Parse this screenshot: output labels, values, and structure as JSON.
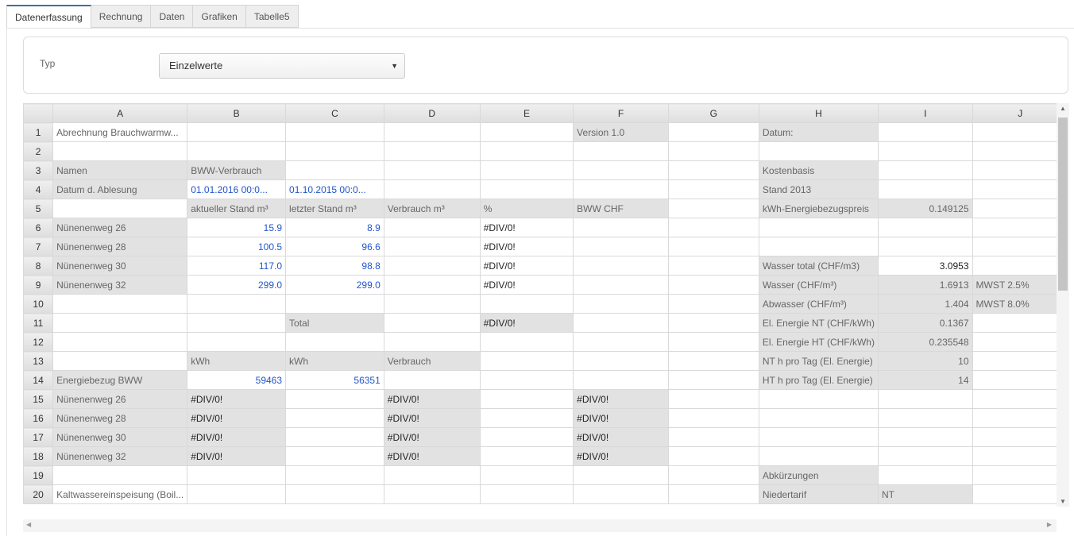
{
  "tabs": [
    "Datenerfassung",
    "Rechnung",
    "Daten",
    "Grafiken",
    "Tabelle5"
  ],
  "active_tab": 0,
  "form": {
    "typ_label": "Typ",
    "typ_value": "Einzelwerte"
  },
  "columns": [
    "A",
    "B",
    "C",
    "D",
    "E",
    "F",
    "G",
    "H",
    "I",
    "J"
  ],
  "rows": [
    [
      [
        "Abrechnung Brauchwarmw...",
        ""
      ],
      [
        "",
        ""
      ],
      [
        "",
        ""
      ],
      [
        "",
        ""
      ],
      [
        "",
        ""
      ],
      [
        "Version 1.0",
        "g"
      ],
      [
        "",
        ""
      ],
      [
        "Datum:",
        "g"
      ],
      [
        "",
        ""
      ],
      [
        "",
        ""
      ]
    ],
    [
      [
        "",
        ""
      ],
      [
        "",
        ""
      ],
      [
        "",
        ""
      ],
      [
        "",
        ""
      ],
      [
        "",
        ""
      ],
      [
        "",
        ""
      ],
      [
        "",
        ""
      ],
      [
        "",
        ""
      ],
      [
        "",
        ""
      ],
      [
        "",
        ""
      ]
    ],
    [
      [
        "Namen",
        "g"
      ],
      [
        "BWW-Verbrauch",
        "g"
      ],
      [
        "",
        ""
      ],
      [
        "",
        ""
      ],
      [
        "",
        ""
      ],
      [
        "",
        ""
      ],
      [
        "",
        ""
      ],
      [
        "Kostenbasis",
        "g"
      ],
      [
        "",
        ""
      ],
      [
        "",
        ""
      ]
    ],
    [
      [
        "Datum d. Ablesung",
        "g"
      ],
      [
        "01.01.2016 00:0...",
        "b"
      ],
      [
        "01.10.2015 00:0...",
        "b"
      ],
      [
        "",
        ""
      ],
      [
        "",
        ""
      ],
      [
        "",
        ""
      ],
      [
        "",
        ""
      ],
      [
        "Stand 2013",
        "g"
      ],
      [
        "",
        ""
      ],
      [
        "",
        ""
      ]
    ],
    [
      [
        "",
        ""
      ],
      [
        "aktueller Stand m³",
        "g"
      ],
      [
        "letzter Stand m³",
        "g"
      ],
      [
        "Verbrauch m³",
        "g"
      ],
      [
        "%",
        "g"
      ],
      [
        "BWW CHF",
        "g"
      ],
      [
        "",
        ""
      ],
      [
        "kWh-Energiebezugspreis",
        "g"
      ],
      [
        "0.149125",
        "gr"
      ],
      [
        "",
        ""
      ]
    ],
    [
      [
        "Nünenenweg 26",
        "g"
      ],
      [
        "15.9",
        "br"
      ],
      [
        "8.9",
        "br"
      ],
      [
        "",
        ""
      ],
      [
        "#DIV/0!",
        "k"
      ],
      [
        "",
        ""
      ],
      [
        "",
        ""
      ],
      [
        "",
        ""
      ],
      [
        "",
        ""
      ],
      [
        "",
        ""
      ]
    ],
    [
      [
        "Nünenenweg 28",
        "g"
      ],
      [
        "100.5",
        "br"
      ],
      [
        "96.6",
        "br"
      ],
      [
        "",
        ""
      ],
      [
        "#DIV/0!",
        "k"
      ],
      [
        "",
        ""
      ],
      [
        "",
        ""
      ],
      [
        "",
        ""
      ],
      [
        "",
        ""
      ],
      [
        "",
        ""
      ]
    ],
    [
      [
        "Nünenenweg 30",
        "g"
      ],
      [
        "117.0",
        "br"
      ],
      [
        "98.8",
        "br"
      ],
      [
        "",
        ""
      ],
      [
        "#DIV/0!",
        "k"
      ],
      [
        "",
        ""
      ],
      [
        "",
        ""
      ],
      [
        "Wasser total (CHF/m3)",
        "g"
      ],
      [
        "3.0953",
        "kr"
      ],
      [
        "",
        ""
      ]
    ],
    [
      [
        "Nünenenweg 32",
        "g"
      ],
      [
        "299.0",
        "br"
      ],
      [
        "299.0",
        "br"
      ],
      [
        "",
        ""
      ],
      [
        "#DIV/0!",
        "k"
      ],
      [
        "",
        ""
      ],
      [
        "",
        ""
      ],
      [
        "Wasser (CHF/m³)",
        "g"
      ],
      [
        "1.6913",
        "gr"
      ],
      [
        "MWST 2.5%",
        "g"
      ]
    ],
    [
      [
        "",
        ""
      ],
      [
        "",
        ""
      ],
      [
        "",
        ""
      ],
      [
        "",
        ""
      ],
      [
        "",
        ""
      ],
      [
        "",
        ""
      ],
      [
        "",
        ""
      ],
      [
        "Abwasser (CHF/m³)",
        "g"
      ],
      [
        "1.404",
        "gr"
      ],
      [
        "MWST 8.0%",
        "g"
      ]
    ],
    [
      [
        "",
        ""
      ],
      [
        "",
        ""
      ],
      [
        "Total",
        "g"
      ],
      [
        "",
        ""
      ],
      [
        "#DIV/0!",
        "gk"
      ],
      [
        "",
        ""
      ],
      [
        "",
        ""
      ],
      [
        "El. Energie NT (CHF/kWh)",
        "g"
      ],
      [
        "0.1367",
        "gr"
      ],
      [
        "",
        ""
      ]
    ],
    [
      [
        "",
        ""
      ],
      [
        "",
        ""
      ],
      [
        "",
        ""
      ],
      [
        "",
        ""
      ],
      [
        "",
        ""
      ],
      [
        "",
        ""
      ],
      [
        "",
        ""
      ],
      [
        "El. Energie HT (CHF/kWh)",
        "g"
      ],
      [
        "0.235548",
        "gr"
      ],
      [
        "",
        ""
      ]
    ],
    [
      [
        "",
        ""
      ],
      [
        "kWh",
        "g"
      ],
      [
        "kWh",
        "g"
      ],
      [
        "Verbrauch",
        "g"
      ],
      [
        "",
        ""
      ],
      [
        "",
        ""
      ],
      [
        "",
        ""
      ],
      [
        "NT h pro Tag (El. Energie)",
        "g"
      ],
      [
        "10",
        "gr"
      ],
      [
        "",
        ""
      ]
    ],
    [
      [
        "Energiebezug BWW",
        "g"
      ],
      [
        "59463",
        "br"
      ],
      [
        "56351",
        "br"
      ],
      [
        "",
        ""
      ],
      [
        "",
        ""
      ],
      [
        "",
        ""
      ],
      [
        "",
        ""
      ],
      [
        "HT h pro Tag (El. Energie)",
        "g"
      ],
      [
        "14",
        "gr"
      ],
      [
        "",
        ""
      ]
    ],
    [
      [
        "Nünenenweg 26",
        "g"
      ],
      [
        "#DIV/0!",
        "gk"
      ],
      [
        "",
        ""
      ],
      [
        "#DIV/0!",
        "gk"
      ],
      [
        "",
        ""
      ],
      [
        "#DIV/0!",
        "gk"
      ],
      [
        "",
        ""
      ],
      [
        "",
        ""
      ],
      [
        "",
        ""
      ],
      [
        "",
        ""
      ]
    ],
    [
      [
        "Nünenenweg 28",
        "g"
      ],
      [
        "#DIV/0!",
        "gk"
      ],
      [
        "",
        ""
      ],
      [
        "#DIV/0!",
        "gk"
      ],
      [
        "",
        ""
      ],
      [
        "#DIV/0!",
        "gk"
      ],
      [
        "",
        ""
      ],
      [
        "",
        ""
      ],
      [
        "",
        ""
      ],
      [
        "",
        ""
      ]
    ],
    [
      [
        "Nünenenweg 30",
        "g"
      ],
      [
        "#DIV/0!",
        "gk"
      ],
      [
        "",
        ""
      ],
      [
        "#DIV/0!",
        "gk"
      ],
      [
        "",
        ""
      ],
      [
        "#DIV/0!",
        "gk"
      ],
      [
        "",
        ""
      ],
      [
        "",
        ""
      ],
      [
        "",
        ""
      ],
      [
        "",
        ""
      ]
    ],
    [
      [
        "Nünenenweg 32",
        "g"
      ],
      [
        "#DIV/0!",
        "gk"
      ],
      [
        "",
        ""
      ],
      [
        "#DIV/0!",
        "gk"
      ],
      [
        "",
        ""
      ],
      [
        "#DIV/0!",
        "gk"
      ],
      [
        "",
        ""
      ],
      [
        "",
        ""
      ],
      [
        "",
        ""
      ],
      [
        "",
        ""
      ]
    ],
    [
      [
        "",
        ""
      ],
      [
        "",
        ""
      ],
      [
        "",
        ""
      ],
      [
        "",
        ""
      ],
      [
        "",
        ""
      ],
      [
        "",
        ""
      ],
      [
        "",
        ""
      ],
      [
        "Abkürzungen",
        "g"
      ],
      [
        "",
        ""
      ],
      [
        "",
        ""
      ]
    ],
    [
      [
        "Kaltwassereinspeisung (Boil...",
        ""
      ],
      [
        "",
        ""
      ],
      [
        "",
        ""
      ],
      [
        "",
        ""
      ],
      [
        "",
        ""
      ],
      [
        "",
        ""
      ],
      [
        "",
        ""
      ],
      [
        "Niedertarif",
        "g"
      ],
      [
        "NT",
        "g"
      ],
      [
        "",
        ""
      ]
    ]
  ],
  "icons": {
    "dropdown": "caret-down-icon",
    "scroll_up": "arrow-up-icon",
    "scroll_down": "arrow-down-icon",
    "scroll_left": "arrow-left-icon",
    "scroll_right": "arrow-right-icon"
  }
}
